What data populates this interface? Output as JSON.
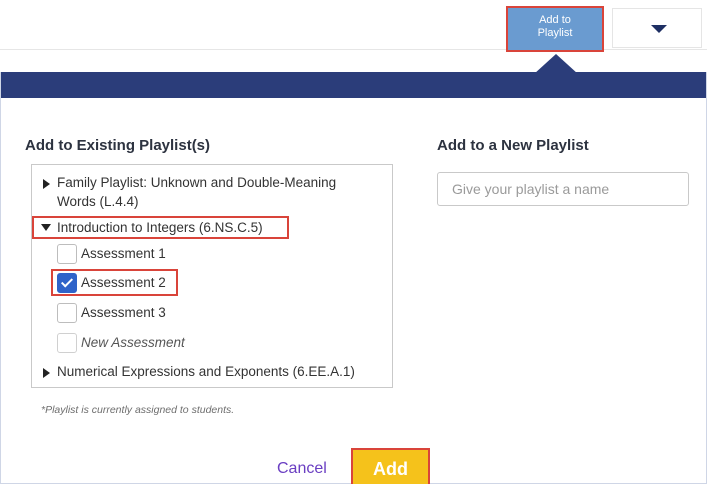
{
  "topbar": {
    "add_to_playlist_line1": "Add to",
    "add_to_playlist_line2": "Playlist"
  },
  "dialog": {
    "existing_title": "Add to Existing Playlist(s)",
    "new_title": "Add to a New Playlist",
    "new_placeholder": "Give your playlist a name",
    "playlists": [
      {
        "label_line1": "Family Playlist: Unknown and Double-Meaning",
        "label_line2": "Words (L.4.4)",
        "expanded": false
      },
      {
        "label": "Introduction to Integers (6.NS.C.5)",
        "expanded": true,
        "items": [
          {
            "label": "Assessment 1",
            "checked": false
          },
          {
            "label": "Assessment 2",
            "checked": true
          },
          {
            "label": "Assessment 3",
            "checked": false
          },
          {
            "label": "New Assessment",
            "checked": false,
            "italic": true
          }
        ]
      },
      {
        "label": "Numerical Expressions and Exponents (6.EE.A.1)",
        "expanded": false
      }
    ],
    "footnote": "*Playlist is currently assigned to students.",
    "cancel_label": "Cancel",
    "add_label": "Add"
  },
  "colors": {
    "header": "#2b3d7a",
    "accent_blue": "#6a9bd0",
    "add_yellow": "#f5c21b",
    "cancel_purple": "#6a3ec2",
    "highlight_red": "#d9443a",
    "checkbox_blue": "#2f63c9"
  },
  "icons": [
    "caret-down-icon",
    "triangle-right-icon",
    "triangle-down-icon",
    "checkmark-icon"
  ]
}
